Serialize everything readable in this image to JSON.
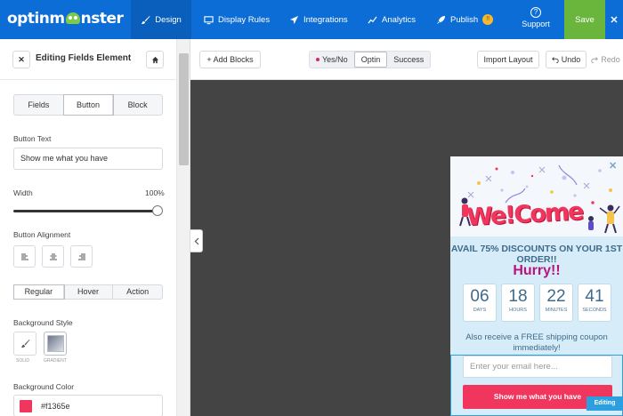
{
  "brand": {
    "logo_text_before": "optinm",
    "logo_text_after": "nster"
  },
  "nav": {
    "design": "Design",
    "display_rules": "Display Rules",
    "integrations": "Integrations",
    "analytics": "Analytics",
    "publish": "Publish",
    "publish_badge": "!!",
    "support_icon": "?",
    "support": "Support",
    "save": "Save",
    "close": "✕"
  },
  "sidebar": {
    "close_icon": "✕",
    "title": "Editing Fields Element",
    "tabs": [
      "Fields",
      "Button",
      "Block"
    ],
    "selected_tab": "Button",
    "button_text_label": "Button Text",
    "button_text_value": "Show me what you have",
    "width_label": "Width",
    "width_value": "100%",
    "width_fraction": 1.0,
    "alignment_label": "Button Alignment",
    "state_tabs": [
      "Regular",
      "Hover",
      "Action"
    ],
    "selected_state": "Regular",
    "bg_style_label": "Background Style",
    "bg_style_options": [
      "Solid",
      "Gradient"
    ],
    "bg_color_label": "Background Color",
    "bg_color_value": "#f1365e"
  },
  "toolbar": {
    "add_blocks": "+ Add Blocks",
    "views": [
      "Yes/No",
      "Optin",
      "Success"
    ],
    "selected_view": "Optin",
    "import_layout": "Import Layout",
    "undo": "Undo",
    "redo": "Redo"
  },
  "popup": {
    "close": "✕",
    "welcome": "We!Come",
    "avail": "AVAIL 75% DISCOUNTS ON YOUR 1ST ORDER!!",
    "hurry": "Hurry!!",
    "countdown": [
      {
        "value": "06",
        "unit": "DAYS"
      },
      {
        "value": "18",
        "unit": "HOURS"
      },
      {
        "value": "22",
        "unit": "MINUTES"
      },
      {
        "value": "41",
        "unit": "SECONDS"
      }
    ],
    "also": "Also receive a FREE shipping coupon immediately!",
    "email_placeholder": "Enter your email here...",
    "cta": "Show me what you have",
    "editing_badge": "Editing"
  },
  "colors": {
    "topbar": "#0c6dd6",
    "save": "#6ab63c",
    "accent_pink": "#f1365e",
    "hurry_magenta": "#b7157d",
    "canvas": "#444444",
    "popup_bg": "#d6edf9"
  }
}
